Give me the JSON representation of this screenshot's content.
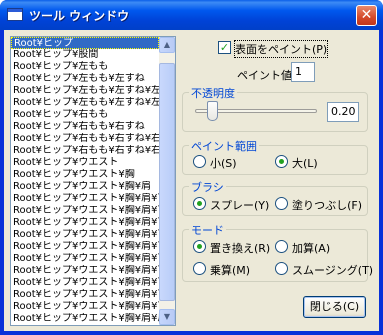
{
  "window": {
    "title": "ツール ウィンドウ",
    "close_glyph": "✕"
  },
  "tree_list": {
    "items": [
      "Root¥ヒップ",
      "Root¥ヒップ¥股間",
      "Root¥ヒップ¥左もも",
      "Root¥ヒップ¥左もも¥左すね",
      "Root¥ヒップ¥左もも¥左すね¥左",
      "Root¥ヒップ¥左もも¥左すね¥左",
      "Root¥ヒップ¥右もも",
      "Root¥ヒップ¥右もも¥右すね",
      "Root¥ヒップ¥右もも¥右すね¥右",
      "Root¥ヒップ¥右もも¥右すね¥右",
      "Root¥ヒップ¥ウエスト",
      "Root¥ヒップ¥ウエスト¥胸",
      "Root¥ヒップ¥ウエスト¥胸¥肩",
      "Root¥ヒップ¥ウエスト¥胸¥肩¥首",
      "Root¥ヒップ¥ウエスト¥胸¥肩¥首",
      "Root¥ヒップ¥ウエスト¥胸¥肩¥首",
      "Root¥ヒップ¥ウエスト¥胸¥肩¥首",
      "Root¥ヒップ¥ウエスト¥胸¥肩¥首",
      "Root¥ヒップ¥ウエスト¥胸¥肩¥首",
      "Root¥ヒップ¥ウエスト¥胸¥肩¥首",
      "Root¥ヒップ¥ウエスト¥胸¥肩¥首",
      "Root¥ヒップ¥ウエスト¥胸¥肩¥首",
      "Root¥ヒップ¥ウエスト¥胸¥肩¥首",
      "Root¥ヒップ¥ウエスト¥胸¥肩¥肩"
    ],
    "selected_index": 0,
    "scroll_up_glyph": "▲",
    "scroll_down_glyph": "▼"
  },
  "paint_surface": {
    "label": "表面をペイント(P)",
    "checked": true,
    "check_glyph": "✓"
  },
  "paint_value": {
    "label": "ペイント値",
    "value": "1"
  },
  "opacity": {
    "title": "不透明度",
    "value": "0.20",
    "level": 0.2
  },
  "paint_range": {
    "title": "ペイント範囲",
    "options": [
      {
        "label": "小(S)",
        "selected": false
      },
      {
        "label": "大(L)",
        "selected": true
      }
    ]
  },
  "brush": {
    "title": "ブラシ",
    "options": [
      {
        "label": "スプレー(Y)",
        "selected": true
      },
      {
        "label": "塗りつぶし(F)",
        "selected": false
      }
    ]
  },
  "mode": {
    "title": "モード",
    "options": [
      {
        "label": "置き換え(R)",
        "selected": true
      },
      {
        "label": "加算(A)",
        "selected": false
      },
      {
        "label": "乗算(M)",
        "selected": false
      },
      {
        "label": "スムージング(T)",
        "selected": false
      }
    ]
  },
  "close_button": {
    "label": "閉じる(C)"
  }
}
